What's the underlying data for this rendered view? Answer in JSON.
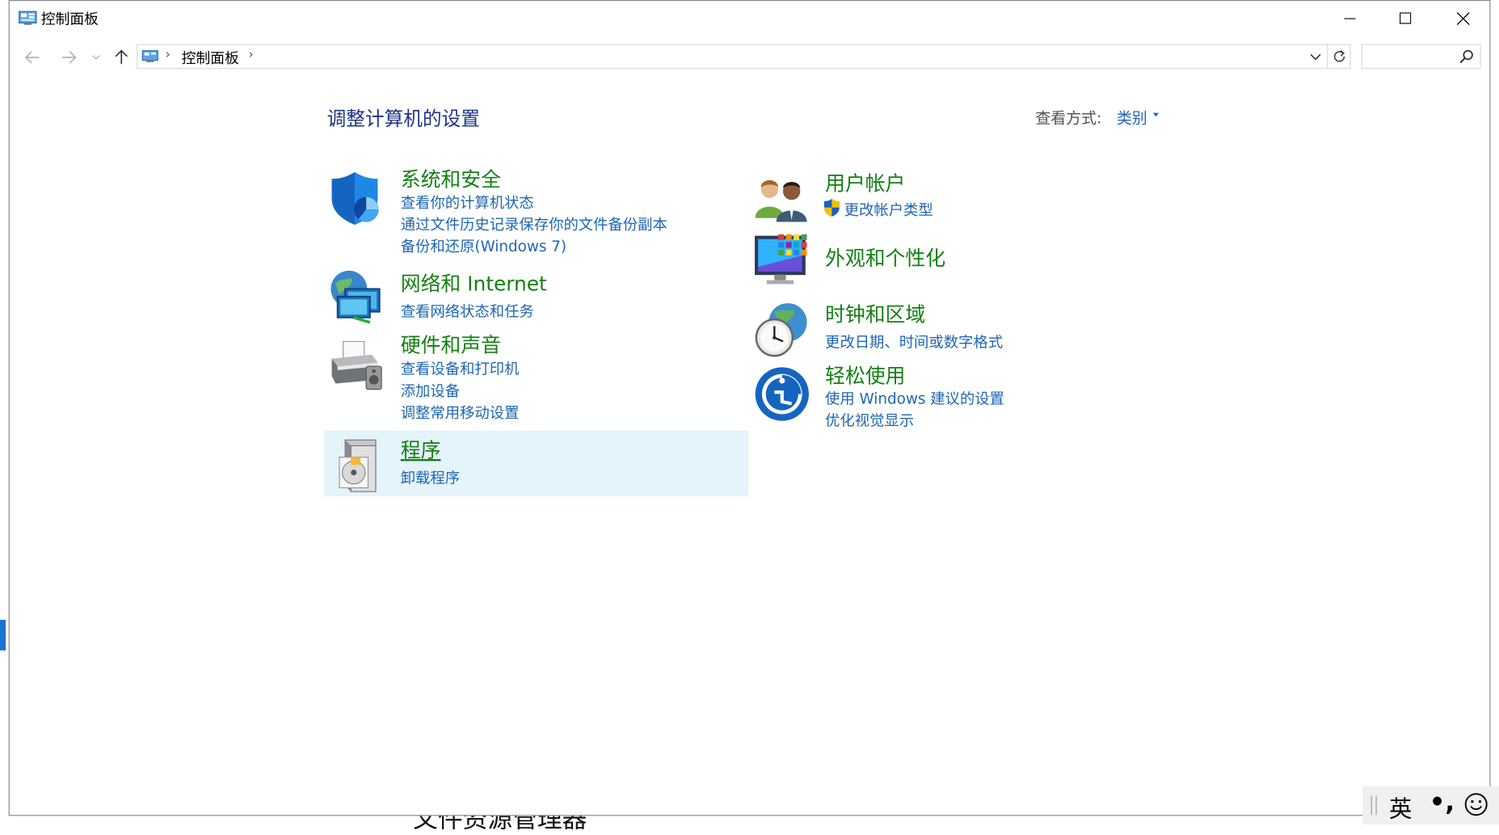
{
  "window": {
    "title": "控制面板",
    "controls": {
      "minimize": "minimize",
      "maximize": "maximize",
      "close": "close"
    }
  },
  "address_bar": {
    "breadcrumb": "控制面板",
    "search": {
      "value": "",
      "placeholder": ""
    }
  },
  "content": {
    "heading": "调整计算机的设置",
    "view_by": {
      "label": "查看方式:",
      "value": "类别"
    },
    "categories": [
      {
        "title": "系统和安全",
        "icon": "shield-icon",
        "links": [
          "查看你的计算机状态",
          "通过文件历史记录保存你的文件备份副本",
          "备份和还原(Windows 7)"
        ]
      },
      {
        "title": "网络和 Internet",
        "icon": "network-icon",
        "links": [
          "查看网络状态和任务"
        ]
      },
      {
        "title": "硬件和声音",
        "icon": "printer-icon",
        "links": [
          "查看设备和打印机",
          "添加设备",
          "调整常用移动设置"
        ]
      },
      {
        "title": "程序",
        "icon": "programs-icon",
        "highlighted": true,
        "links": [
          "卸载程序"
        ]
      },
      {
        "title": "用户帐户",
        "icon": "users-icon",
        "links": [
          "更改帐户类型"
        ]
      },
      {
        "title": "外观和个性化",
        "icon": "appearance-icon",
        "links": []
      },
      {
        "title": "时钟和区域",
        "icon": "clock-icon",
        "links": [
          "更改日期、时间或数字格式"
        ]
      },
      {
        "title": "轻松使用",
        "icon": "ease-of-access-icon",
        "links": [
          "使用 Windows 建议的设置",
          "优化视觉显示"
        ]
      }
    ]
  },
  "background": {
    "partial_window_text": "文件资源管理器"
  },
  "ime": {
    "language": "英",
    "punctuation": "•,",
    "emoji": "smiley-icon"
  },
  "colors": {
    "category_title": "#138013",
    "link": "#1e66b4",
    "heading": "#1e3287",
    "hover_highlight": "#e5f3fb"
  }
}
